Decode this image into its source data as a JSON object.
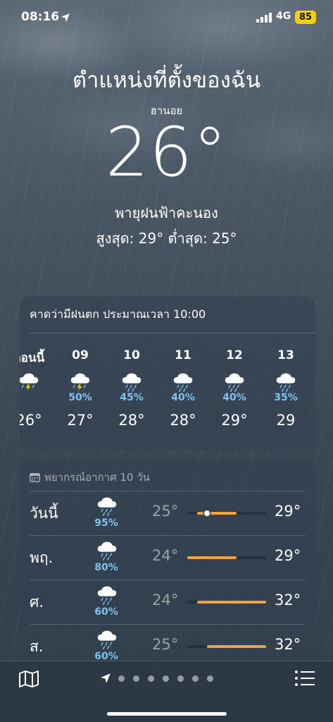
{
  "status_bar": {
    "time": "08:16",
    "network": "4G",
    "battery": "85"
  },
  "header": {
    "title": "ตำแหน่งที่ตั้งของฉัน",
    "city": "ฮานอย",
    "temperature": "26°",
    "condition": "พายุฝนฟ้าคะนอง",
    "high_low": "สูงสุด: 29°  ต่ำสุด: 25°"
  },
  "hourly": {
    "summary": "คาดว่ามีฝนตก ประมาณเวลา 10:00",
    "items": [
      {
        "label": "ตอนนี้",
        "icon": "thunderstorm-icon",
        "pop": "",
        "temp": "26°"
      },
      {
        "label": "09",
        "icon": "thunderstorm-icon",
        "pop": "50%",
        "temp": "27°"
      },
      {
        "label": "10",
        "icon": "rain-cloud-icon",
        "pop": "45%",
        "temp": "28°"
      },
      {
        "label": "11",
        "icon": "rain-cloud-icon",
        "pop": "40%",
        "temp": "28°"
      },
      {
        "label": "12",
        "icon": "rain-cloud-icon",
        "pop": "40%",
        "temp": "29°"
      },
      {
        "label": "13",
        "icon": "rain-cloud-icon",
        "pop": "35%",
        "temp": "29"
      }
    ]
  },
  "daily": {
    "header": "พยากรณ์อากาศ 10 วัน",
    "range_scale": [
      24,
      32
    ],
    "items": [
      {
        "day": "วันนี้",
        "icon": "rain-cloud-icon",
        "pop": "95%",
        "low": "25°",
        "high": "29°",
        "low_val": 25,
        "high_val": 29,
        "current_val": 26
      },
      {
        "day": "พฤ.",
        "icon": "rain-cloud-icon",
        "pop": "80%",
        "low": "24°",
        "high": "29°",
        "low_val": 24,
        "high_val": 29
      },
      {
        "day": "ศ.",
        "icon": "rain-cloud-icon",
        "pop": "60%",
        "low": "24°",
        "high": "32°",
        "low_val": 25,
        "high_val": 32
      },
      {
        "day": "ส.",
        "icon": "rain-cloud-icon",
        "pop": "60%",
        "low": "25°",
        "high": "32°",
        "low_val": 26,
        "high_val": 32
      }
    ]
  },
  "bottom_bar": {
    "page_count": 8,
    "active_page": 0
  },
  "colors": {
    "accent_blue": "#7cc4f2",
    "range_orange": "#f0a43a",
    "battery_yellow": "#f5d100"
  }
}
